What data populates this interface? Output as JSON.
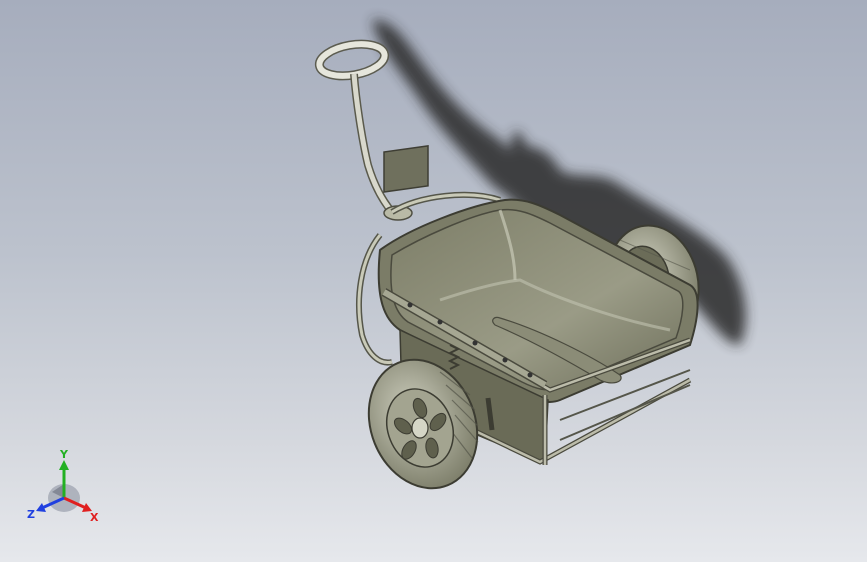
{
  "model_view": {
    "subject_icon": "garden-cart-3d-model",
    "background_top": "#a6adbd",
    "background_bottom": "#e6e8ec",
    "body_color": "#8e8f79",
    "tire_color": "#a4a592",
    "shadow_color": "#222222"
  },
  "triad": {
    "x_label": "X",
    "y_label": "Y",
    "z_label": "Z",
    "x_color": "#e02020",
    "y_color": "#22b022",
    "z_color": "#2040e0"
  }
}
